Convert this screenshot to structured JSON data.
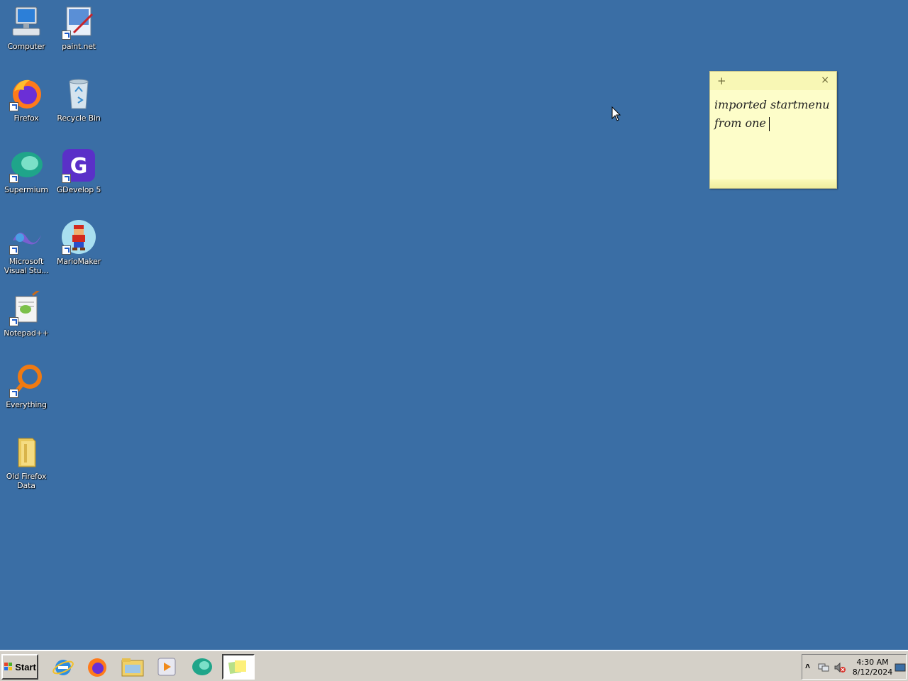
{
  "desktop": {
    "icons": [
      {
        "label": "Computer",
        "icon": "computer-icon"
      },
      {
        "label": "paint.net",
        "icon": "paintnet-icon"
      },
      {
        "label": "Firefox",
        "icon": "firefox-icon"
      },
      {
        "label": "Recycle Bin",
        "icon": "recycle-bin-icon"
      },
      {
        "label": "Supermium",
        "icon": "supermium-icon"
      },
      {
        "label": "GDevelop 5",
        "icon": "gdevelop-icon"
      },
      {
        "label": "Microsoft Visual Stu...",
        "icon": "visual-studio-icon"
      },
      {
        "label": "MarioMaker",
        "icon": "mariomaker-icon"
      },
      {
        "label": "Notepad++",
        "icon": "notepadpp-icon"
      },
      {
        "label": "Everything",
        "icon": "everything-icon"
      },
      {
        "label": "Old Firefox Data",
        "icon": "folder-icon"
      }
    ]
  },
  "sticky_note": {
    "add_glyph": "+",
    "close_glyph": "×",
    "line1": "imported startmenu",
    "line2": "from one"
  },
  "taskbar": {
    "start_label": "Start",
    "items": [
      "internet-explorer-icon",
      "firefox-icon",
      "file-explorer-icon",
      "media-player-icon",
      "supermium-icon",
      "sticky-notes-icon"
    ],
    "tray": {
      "expand_glyph": "˄",
      "time": "4:30 AM",
      "date": "8/12/2024"
    }
  },
  "colors": {
    "desktop": "#3a6ea5",
    "taskbar": "#d4d0c8",
    "sticky": "#fdfdc9"
  }
}
